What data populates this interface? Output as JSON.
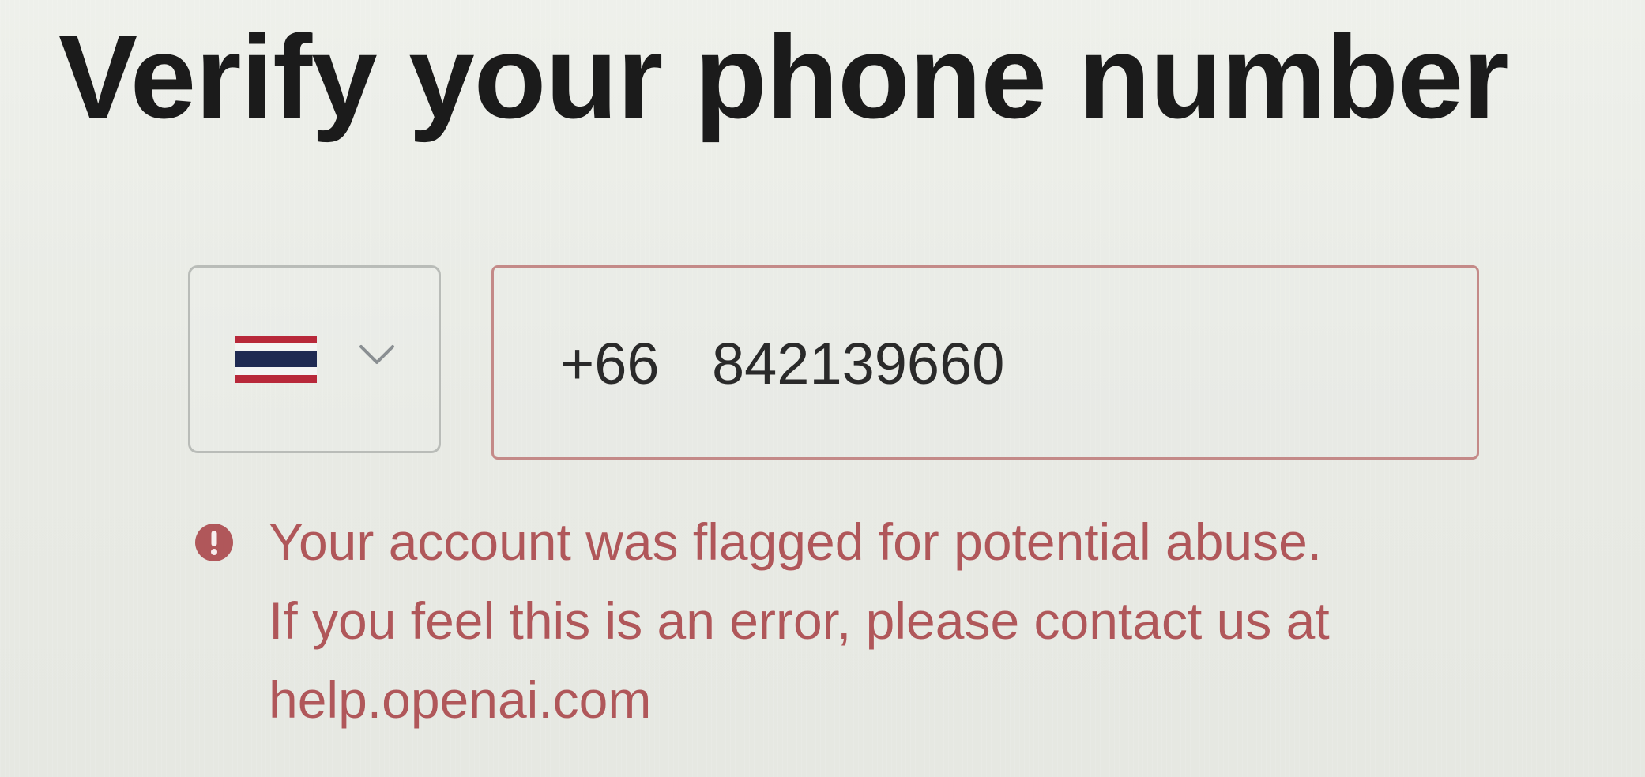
{
  "page": {
    "title": "Verify your phone number"
  },
  "country_select": {
    "selected_country_flag": "thailand-flag-icon",
    "chevron": "chevron-down-icon"
  },
  "phone": {
    "dial_code": "+66",
    "number": "842139660"
  },
  "error": {
    "icon": "error-icon",
    "line1": "Your account was flagged for potential abuse.",
    "line2": "If you feel this is an error, please contact us at",
    "link": "help.openai.com"
  },
  "colors": {
    "title": "#1b1b1b",
    "error": "#b0575a",
    "error_border": "#c48a88",
    "flag_red": "#b8283a",
    "flag_blue": "#1f2a52",
    "flag_white": "#f4f4f4",
    "background": "#e9ebe6"
  }
}
